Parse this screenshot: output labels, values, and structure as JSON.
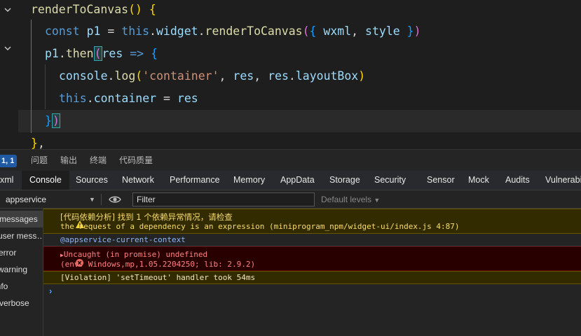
{
  "editor": {
    "lines": [
      "renderToCanvas() {",
      "const p1 = this.widget.renderToCanvas({ wxml, style })",
      "p1.then(res => {",
      "console.log('container', res, res.layoutBox)",
      "this.container = res",
      "})",
      "},"
    ]
  },
  "panel": {
    "cursor_badge": "1, 1",
    "tabs": [
      "问题",
      "输出",
      "终端",
      "代码质量"
    ]
  },
  "devtools": {
    "tabs": [
      "xml",
      "Console",
      "Sources",
      "Network",
      "Performance",
      "Memory",
      "AppData",
      "Storage",
      "Security",
      "Sensor",
      "Mock",
      "Audits",
      "Vulnerabi"
    ],
    "active_tab": "Console"
  },
  "toolbar": {
    "context": "appservice",
    "filter_placeholder": "Filter",
    "levels": "Default levels"
  },
  "sidebar": {
    "items": [
      "messages",
      "user mess…",
      "error",
      "warning",
      "info",
      "verbose"
    ]
  },
  "console": {
    "warning": {
      "line1": "[代码依赖分析] 找到 1 个依赖异常情况，请检查",
      "line2": "the request of a dependency is an expression (miniprogram_npm/widget-ui/index.js 4:87)"
    },
    "context_line": "@appservice-current-context",
    "error": {
      "line1": "Uncaught (in promise) undefined",
      "line2": "(env: Windows,mp,1.05.2204250; lib: 2.9.2)"
    },
    "violation": "[Violation] 'setTimeout' handler took 54ms"
  },
  "colors": {
    "editor_bg": "#1e1e1e",
    "warning_bg": "#332b00",
    "error_bg": "#290000",
    "accent": "#1f5aa3"
  }
}
